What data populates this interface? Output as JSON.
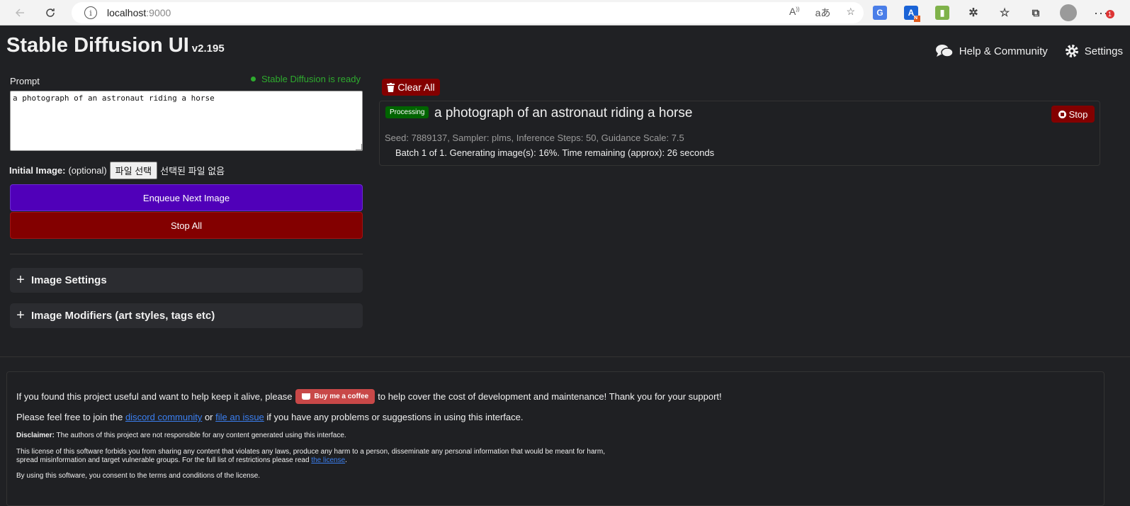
{
  "browser": {
    "url_host": "localhost",
    "url_port": ":9000",
    "notification_count": "1"
  },
  "app": {
    "title": "Stable Diffusion UI",
    "version": "v2.195",
    "help_label": "Help & Community",
    "settings_label": "Settings"
  },
  "editor": {
    "prompt_label": "Prompt",
    "status_text": "Stable Diffusion is ready",
    "prompt_value": "a photograph of an astronaut riding a horse",
    "initial_image_label": "Initial Image:",
    "initial_image_optional": "(optional)",
    "file_button": "파일 선택",
    "file_none": "선택된 파일 없음",
    "enqueue_label": "Enqueue Next Image",
    "stop_all_label": "Stop All",
    "image_settings_label": "Image Settings",
    "image_modifiers_label": "Image Modifiers (art styles, tags etc)"
  },
  "queue": {
    "clear_all_label": "Clear All",
    "task": {
      "badge": "Processing",
      "prompt": "a photograph of an astronaut riding a horse",
      "stop_label": "Stop",
      "meta": "Seed: 7889137, Sampler: plms, Inference Steps: 50, Guidance Scale: 7.5",
      "progress_text": "Batch 1 of 1. Generating image(s): 16%. Time remaining (approx): 26 seconds"
    }
  },
  "footer": {
    "support_prefix": "If you found this project useful and want to help keep it alive, please",
    "coffee_label": "Buy me a coffee",
    "support_suffix": "to help cover the cost of development and maintenance! Thank you for your support!",
    "join_prefix": "Please feel free to join the",
    "discord_link": "discord community",
    "join_or": "or",
    "issue_link": "file an issue",
    "join_suffix": "if you have any problems or suggestions in using this interface.",
    "disclaimer_label": "Disclaimer:",
    "disclaimer_text": "The authors of this project are not responsible for any content generated using this interface.",
    "license_line1": "This license of this software forbids you from sharing any content that violates any laws, produce any harm to a person, disseminate any personal information that would be meant for harm,",
    "license_line2_prefix": "spread misinformation and target vulnerable groups. For the full list of restrictions please read",
    "license_link": "the license",
    "license_line2_suffix": ".",
    "consent_text": "By using this software, you consent to the terms and conditions of the license."
  }
}
